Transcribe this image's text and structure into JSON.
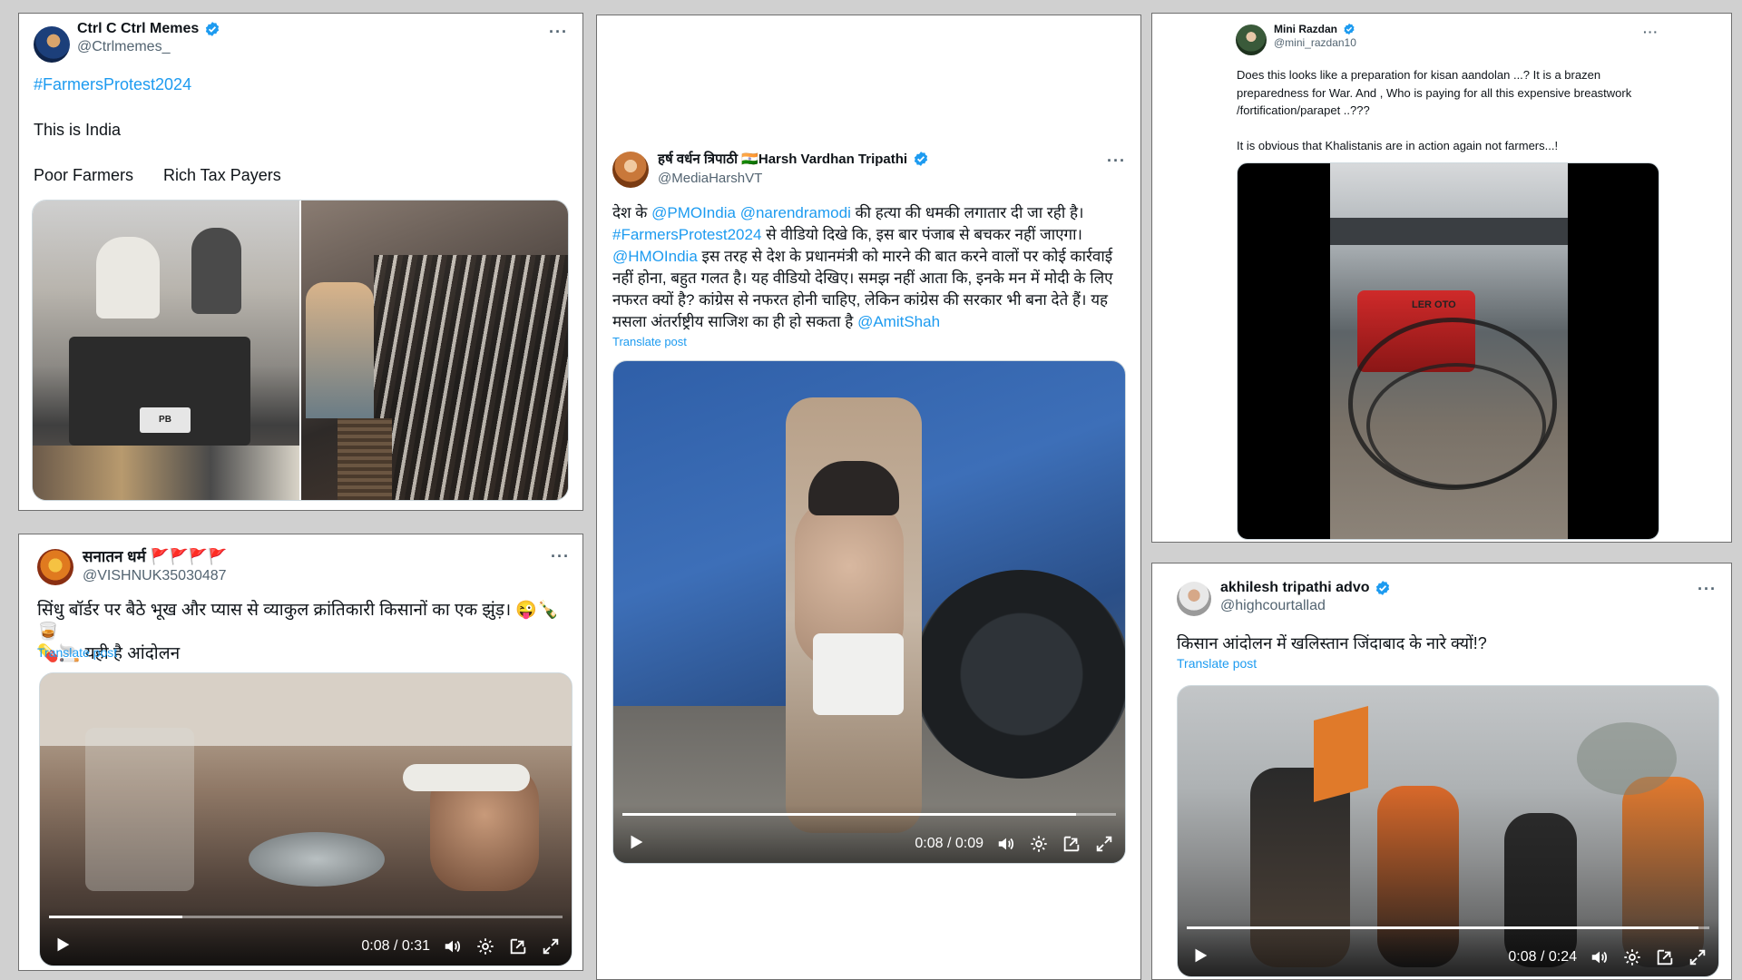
{
  "colors": {
    "link": "#1d9bf0",
    "verified": "#1d9bf0",
    "handle": "#536471"
  },
  "posts": [
    {
      "display_name": "Ctrl C Ctrl Memes",
      "handle": "@Ctrlmemes_",
      "verified": true,
      "more_label": "···",
      "hashtag": "#FarmersProtest2024",
      "line1": "This is India",
      "label_left": "Poor Farmers",
      "label_right": "Rich Tax Payers",
      "images": [
        "image-farmers-on-mercedes",
        "image-crowded-train-platform"
      ],
      "plate_text": "PB"
    },
    {
      "display_name": "सनातन धर्म 🚩🚩🚩🚩",
      "handle": "@VISHNUK35030487",
      "verified": false,
      "more_label": "···",
      "text": "सिंधु बॉर्डर पर बैठे भूख और प्यास से व्याकुल क्रांतिकारी किसानों का एक झुंड़। 😜🍾🥃\n💊🚬 यही है आंदोलन",
      "translate": "Translate post",
      "video": {
        "time": "0:08 / 0:31",
        "progress": 0.26
      }
    },
    {
      "display_name": "हर्ष वर्धन त्रिपाठी 🇮🇳Harsh Vardhan Tripathi",
      "handle": "@MediaHarshVT",
      "verified": true,
      "more_label": "···",
      "text_parts": {
        "p1": "देश के ",
        "m1": "@PMOIndia",
        "p2": " ",
        "m2": "@narendramodi",
        "p3": " की हत्या की धमकी लगातार दी जा रही है।",
        "h1": "#FarmersProtest2024",
        "p4": " से वीडियो दिखे कि, इस बार पंजाब से बचकर नहीं जाएगा।",
        "m3": "@HMOIndia",
        "p5": " इस तरह से देश के प्रधानमंत्री को मारने की बात करने वालों पर कोई कार्रवाई नहीं होना, बहुत गलत है। यह वीडियो देखिए। समझ नहीं आता कि, इनके मन में मोदी के लिए नफरत क्यों है? कांग्रेस से नफरत होनी चाहिए, लेकिन कांग्रेस की सरकार भी बना देते हैं। यह मसला अंतर्राष्ट्रीय साजिश का ही हो सकता है ",
        "m4": "@AmitShah"
      },
      "translate": "Translate post",
      "video": {
        "time": "0:08 / 0:09",
        "progress": 0.92
      }
    },
    {
      "display_name": "Mini Razdan",
      "handle": "@mini_razdan10",
      "verified": true,
      "more_label": "···",
      "text": "Does this looks like a preparation for kisan aandolan ...?  It is a brazen preparedness for War.  And , Who is paying for all this expensive breastwork /fortification/parapet  ..???\n\nIt is obvious that Khalistanis are in action again not farmers...!",
      "sign_text": "LER OTO"
    },
    {
      "display_name": "akhilesh tripathi advo",
      "handle": "@highcourtallad",
      "verified": true,
      "more_label": "···",
      "text": "किसान आंदोलन में खलिस्तान जिंदाबाद के नारे क्यों!?",
      "translate": "Translate post",
      "video": {
        "time": "0:08 / 0:24",
        "progress": 0.98
      }
    }
  ]
}
